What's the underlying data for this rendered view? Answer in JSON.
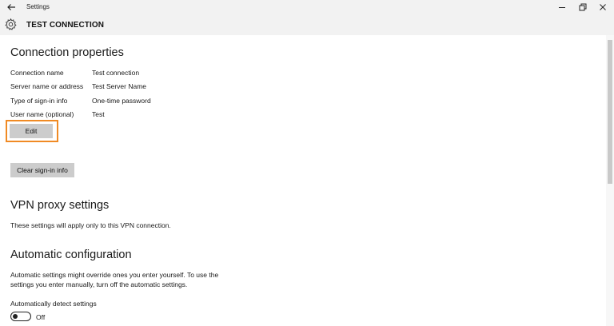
{
  "window": {
    "app_title": "Settings"
  },
  "header": {
    "title": "TEST CONNECTION"
  },
  "connection_properties": {
    "heading": "Connection properties",
    "rows": [
      {
        "label": "Connection name",
        "value": "Test connection"
      },
      {
        "label": "Server name or address",
        "value": "Test Server Name"
      },
      {
        "label": "Type of sign-in info",
        "value": "One-time password"
      },
      {
        "label": "User name (optional)",
        "value": "Test"
      }
    ],
    "edit_label": "Edit",
    "clear_label": "Clear sign-in info"
  },
  "vpn_proxy": {
    "heading": "VPN proxy settings",
    "description": "These settings will apply only to this VPN connection."
  },
  "auto_config": {
    "heading": "Automatic configuration",
    "description": "Automatic settings might override ones you enter yourself. To use the settings you enter manually, turn off the automatic settings.",
    "detect_label": "Automatically detect settings",
    "detect_state": "Off"
  },
  "icons": {
    "back": "back-arrow-icon",
    "settings": "gear-icon",
    "minimize": "minimize-icon",
    "maximize": "maximize-icon",
    "close": "close-icon"
  },
  "colors": {
    "highlight": "#f08a24",
    "chrome": "#f2f2f2",
    "button": "#cccccc"
  }
}
